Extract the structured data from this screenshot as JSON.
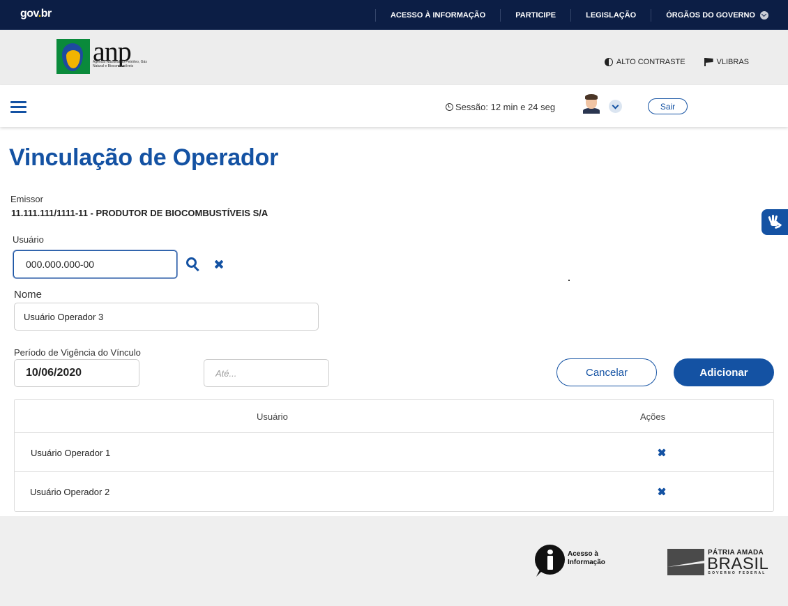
{
  "govbar": {
    "logo_text": "gov",
    "logo_dot": ".",
    "logo_suffix": "br",
    "nav": [
      "ACESSO À INFORMAÇÃO",
      "PARTICIPE",
      "LEGISLAÇÃO",
      "ÓRGÃOS DO GOVERNO"
    ]
  },
  "header": {
    "logo_word": "anp",
    "logo_subtitle": "Agência Nacional do Petróleo, Gás Natural e Biocombustíveis",
    "alto_contraste": "ALTO CONTRASTE",
    "vlibras": "VLIBRAS"
  },
  "session": {
    "text": "Sessão: 12 min e 24 seg",
    "logout_label": "Sair"
  },
  "page": {
    "title": "Vinculação de Operador",
    "emissor_label": "Emissor",
    "emissor_value": "11.111.111/1111-11 - PRODUTOR DE BIOCOMBUSTÍVEIS S/A",
    "usuario_label": "Usuário",
    "usuario_value": "000.000.000-00",
    "nome_label": "Nome",
    "nome_value": "Usuário Operador 3",
    "periodo_label": "Período de Vigência do Vínculo",
    "date_from": "10/06/2020",
    "date_to_placeholder": "Até...",
    "cancel_label": "Cancelar",
    "add_label": "Adicionar"
  },
  "table": {
    "columns": [
      "Usuário",
      "Ações"
    ],
    "rows": [
      {
        "usuario": "Usuário Operador 1"
      },
      {
        "usuario": "Usuário Operador 2"
      }
    ]
  },
  "footer": {
    "acesso_line1": "Acesso à",
    "acesso_line2": "Informação",
    "patria": "PÁTRIA AMADA",
    "brasil": "BRASIL",
    "governo": "GOVERNO FEDERAL"
  },
  "colors": {
    "primary": "#1452a3",
    "govbar": "#0c1e45"
  }
}
